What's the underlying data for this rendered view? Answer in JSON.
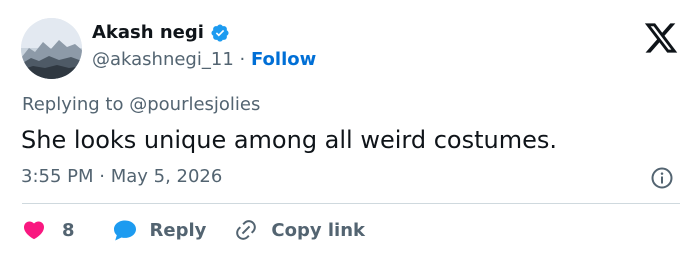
{
  "author": {
    "display_name": "Akash negi",
    "handle": "@akashnegi_11",
    "separator": "·",
    "follow_label": "Follow",
    "verified_icon": "verified-badge-icon",
    "avatar": "mountain-landscape-avatar"
  },
  "brand": {
    "logo": "x-logo-icon"
  },
  "reply_context": {
    "prefix": "Replying to",
    "target": "@pourlesjolies"
  },
  "tweet": {
    "text": "She looks unique among all weird costumes.",
    "timestamp": "3:55 PM · May 5, 2026"
  },
  "actions": {
    "like": {
      "icon": "heart-icon",
      "count": "8"
    },
    "reply": {
      "icon": "speech-bubble-icon",
      "label": "Reply"
    },
    "copy_link": {
      "icon": "link-icon",
      "label": "Copy link"
    },
    "info": {
      "icon": "info-icon"
    }
  },
  "colors": {
    "text": "#0f1419",
    "secondary": "#536471",
    "follow": "#006fd6",
    "verified": "#1d9bf0",
    "like": "#f91880",
    "reply": "#1d9bf0",
    "divider": "#cfd9de"
  }
}
